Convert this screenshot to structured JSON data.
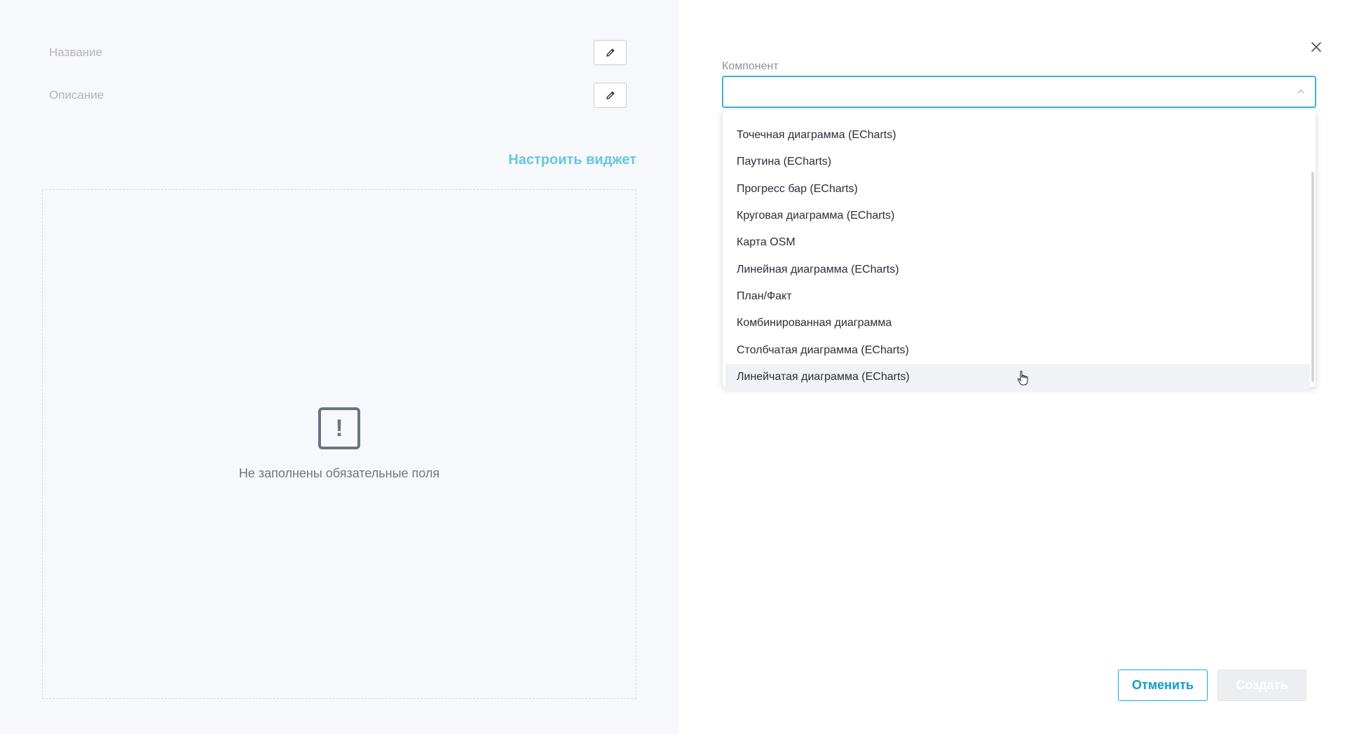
{
  "left": {
    "name_label": "Название",
    "description_label": "Описание",
    "configure_link": "Настроить виджет",
    "empty_message": "Не заполнены обязательные поля"
  },
  "right": {
    "component_label": "Компонент",
    "select_value": "",
    "dropdown_items": [
      "Точечная диаграмма (ECharts)",
      "Паутина (ECharts)",
      "Прогресс бар (ECharts)",
      "Круговая диаграмма (ECharts)",
      "Карта OSM",
      "Линейная диаграмма (ECharts)",
      "План/Факт",
      "Комбинированная диаграмма",
      "Столбчатая диаграмма (ECharts)",
      "Линейчатая диаграмма (ECharts)"
    ],
    "hovered_item": "Линейчатая диаграмма (ECharts)",
    "cancel_label": "Отменить",
    "create_label": "Создать"
  },
  "colors": {
    "accent": "#16a7cf",
    "focus_border": "#3bb3d6",
    "link": "#66c7e0",
    "left_bg": "#f7f8fb"
  },
  "icons": [
    "pencil-icon",
    "warning-icon",
    "close-icon",
    "chevron-up-icon",
    "hand-cursor-icon"
  ]
}
